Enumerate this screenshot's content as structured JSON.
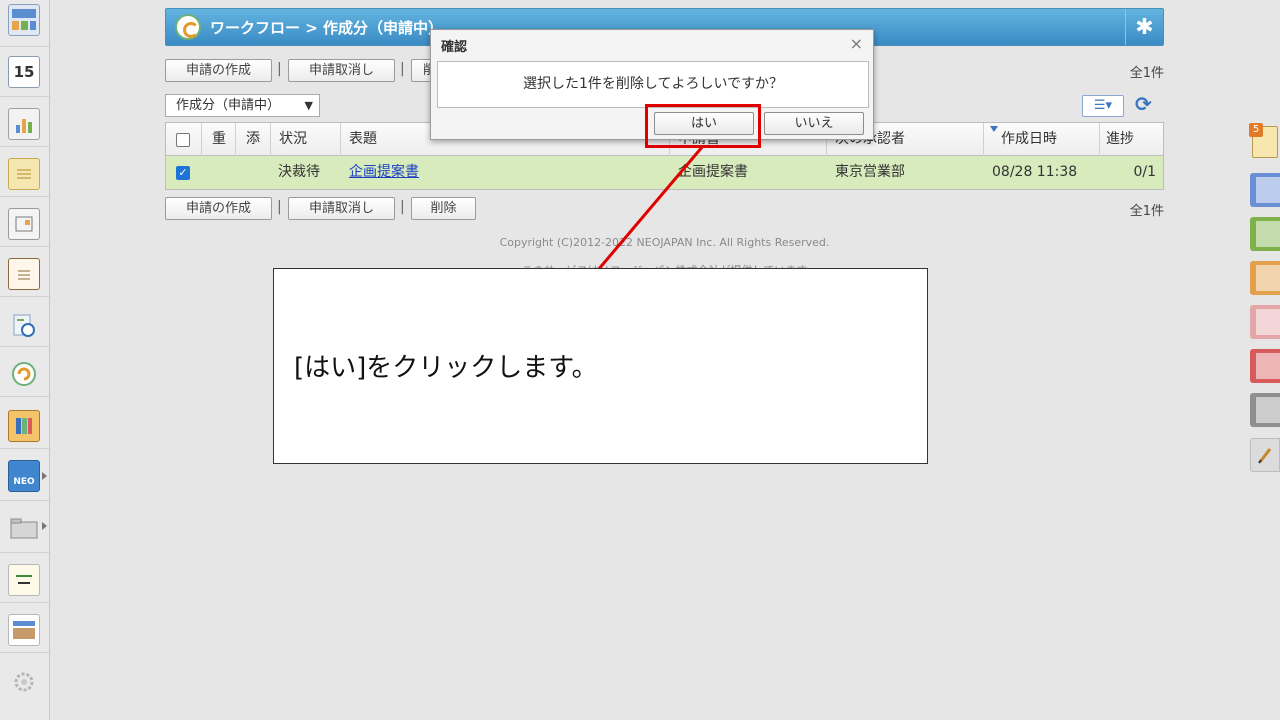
{
  "header": {
    "title": "ワークフロー > 作成分（申請中）"
  },
  "toolbar": {
    "create_label": "申請の作成",
    "cancel_label": "申請取消し",
    "delete_label": "削除",
    "count": "全1件"
  },
  "filter": {
    "selected": "作成分（申請中）"
  },
  "table": {
    "columns": [
      "重",
      "添",
      "状況",
      "表題",
      "申請書",
      "次の承認者",
      "作成日時",
      "進捗"
    ],
    "rows": [
      {
        "status": "決裁待",
        "subject": "企画提案書",
        "form": "企画提案書",
        "approver": "東京営業部",
        "created": "08/28 11:38",
        "progress": "0/1",
        "checked": true
      }
    ]
  },
  "footer": {
    "copyright": "Copyright (C)2012-2022 NEOJAPAN Inc. All Rights Reserved.",
    "note": "このサービスはリコージャパン株式会社が提供しています"
  },
  "dialog": {
    "title": "確認",
    "message": "選択した1件を削除してよろしいですか？",
    "yes_label": "はい",
    "no_label": "いいえ"
  },
  "left_rail": {
    "calendar_day": "15",
    "icons": [
      "portal-icon",
      "calendar-icon",
      "report-icon",
      "memo-icon",
      "board-icon",
      "notepad-icon",
      "todo-search-icon",
      "workflow-icon",
      "cabinet-icon",
      "neo-icon",
      "folder-icon",
      "tanomail-icon",
      "media-icon",
      "settings-icon"
    ]
  },
  "right_dock": {
    "badge": "5",
    "tag_colors": [
      "#6b8fd6",
      "#7fb14b",
      "#e3a14d",
      "#e5a6a9",
      "#d85b5b",
      "#8f8f8f"
    ]
  },
  "annotation": {
    "instruction": "[はい]をクリックします。"
  }
}
